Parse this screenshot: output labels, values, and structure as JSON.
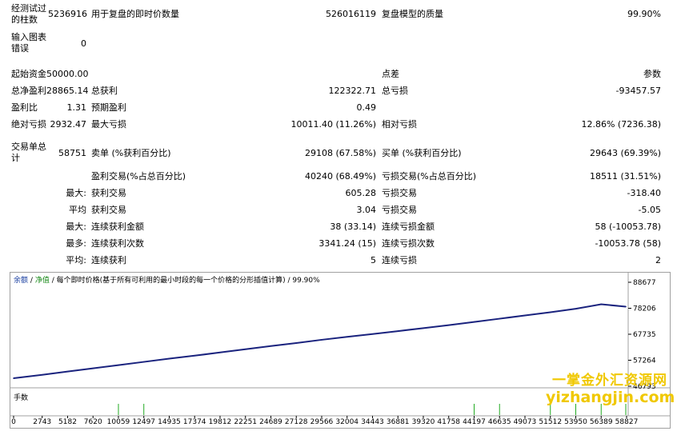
{
  "report": {
    "bars_tested_label": "经测试过的柱数",
    "bars_tested_value": "5236916",
    "ticks_label": "用于复盘的即时价数量",
    "ticks_value": "526016119",
    "quality_label": "复盘模型的质量",
    "quality_value": "99.90%",
    "errors_label": "输入图表错误",
    "errors_value": "0",
    "deposit_label": "起始资金",
    "deposit_value": "50000.00",
    "spread_label": "点差",
    "spread_value": "参数",
    "net_profit_label": "总净盈利",
    "net_profit_value": "28865.14",
    "gross_profit_label": "总获利",
    "gross_profit_value": "122322.71",
    "gross_loss_label": "总亏损",
    "gross_loss_value": "-93457.57",
    "profit_factor_label": "盈利比",
    "profit_factor_value": "1.31",
    "expected_payoff_label": "预期盈利",
    "expected_payoff_value": "0.49",
    "abs_drawdown_label": "绝对亏损",
    "abs_drawdown_value": "2932.47",
    "max_drawdown_label": "最大亏损",
    "max_drawdown_value": "10011.40 (11.26%)",
    "rel_drawdown_label": "相对亏损",
    "rel_drawdown_value": "12.86% (7236.38)",
    "total_trades_label": "交易单总计",
    "total_trades_value": "58751",
    "short_label": "卖单 (%获利百分比)",
    "short_value": "29108 (67.58%)",
    "long_label": "买单 (%获利百分比)",
    "long_value": "29643 (69.39%)",
    "profit_trades_label": "盈利交易(%占总百分比)",
    "profit_trades_value": "40240 (68.49%)",
    "loss_trades_label": "亏损交易(%占总百分比)",
    "loss_trades_value": "18511 (31.51%)",
    "largest_prefix": "最大:",
    "largest_profit_label": "获利交易",
    "largest_profit_value": "605.28",
    "largest_loss_label": "亏损交易",
    "largest_loss_value": "-318.40",
    "average_prefix": "平均",
    "average_profit_label": "获利交易",
    "average_profit_value": "3.04",
    "average_loss_label": "亏损交易",
    "average_loss_value": "-5.05",
    "max_prefix": "最大:",
    "max_consec_wins_label": "连续获利金额",
    "max_consec_wins_value": "38 (33.14)",
    "max_consec_losses_label": "连续亏损金额",
    "max_consec_losses_value": "58 (-10053.78)",
    "maximal_prefix": "最多:",
    "maximal_consec_profit_label": "连续获利次数",
    "maximal_consec_profit_value": "3341.24 (15)",
    "maximal_consec_loss_label": "连续亏损次数",
    "maximal_consec_loss_value": "-10053.78 (58)",
    "avg_prefix": "平均:",
    "avg_consec_wins_label": "连续获利",
    "avg_consec_wins_value": "5",
    "avg_consec_losses_label": "连续亏损",
    "avg_consec_losses_value": "2"
  },
  "chart": {
    "legend_balance": "余额",
    "legend_sep1": "/",
    "legend_equity": "净值",
    "legend_rest": "/ 每个即时价格(基于所有可利用的最小时段的每一个价格的分形插值计算) / 99.90%",
    "volume_label": "手数",
    "line_color": "#1a237e",
    "volume_color": "#22aa22"
  },
  "watermark": {
    "line1": "一掌金外汇资源网",
    "line2": "yizhangjin.com"
  },
  "chart_data": {
    "type": "line",
    "title": "",
    "xlabel": "",
    "ylabel": "",
    "x_ticks": [
      "0",
      "2743",
      "5182",
      "7620",
      "10059",
      "12497",
      "14935",
      "17374",
      "19812",
      "22251",
      "24689",
      "27128",
      "29566",
      "32004",
      "34443",
      "36881",
      "39320",
      "41758",
      "44197",
      "46635",
      "49073",
      "51512",
      "53950",
      "56389",
      "58827"
    ],
    "y_ticks": [
      "88677",
      "78206",
      "67735",
      "57264",
      "46793"
    ],
    "ylim": [
      46793,
      88677
    ],
    "xlim": [
      0,
      58827
    ],
    "series": [
      {
        "name": "余额",
        "x": [
          0,
          2743,
          5182,
          7620,
          10059,
          12497,
          14935,
          17374,
          19812,
          22251,
          24689,
          27128,
          29566,
          32004,
          34443,
          36881,
          39320,
          41758,
          44197,
          46635,
          49073,
          51512,
          53950,
          56389,
          58751
        ],
        "y": [
          50000,
          51400,
          52700,
          54000,
          55300,
          56600,
          57900,
          59100,
          60400,
          61700,
          63000,
          64200,
          65500,
          66700,
          67800,
          69000,
          70200,
          71400,
          72700,
          74000,
          75300,
          76600,
          78000,
          79800,
          78865
        ]
      }
    ],
    "volume_spikes_x": [
      10059,
      12497,
      44197,
      46635,
      51512,
      53950,
      56389,
      58751
    ]
  }
}
